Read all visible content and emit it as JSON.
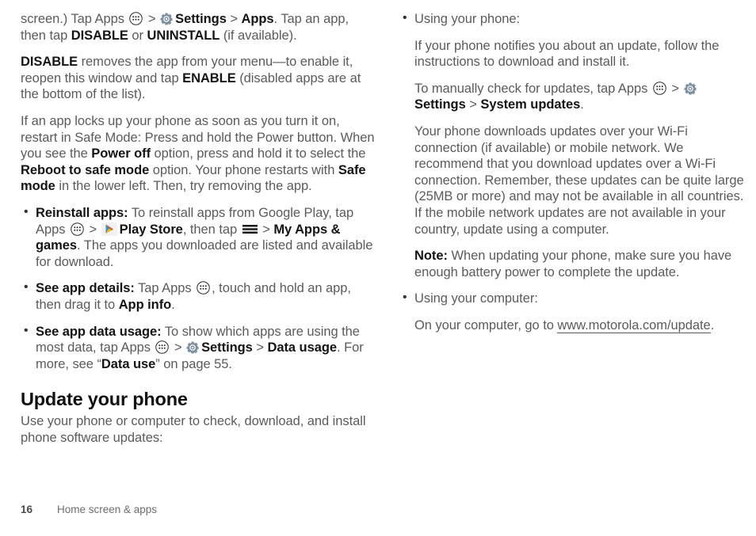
{
  "document": {
    "type": "user-guide-page",
    "page_number": "16",
    "chapter": "Home screen & apps"
  },
  "colors": {
    "body_text": "#5b5b5d",
    "bold_text": "#141414",
    "gear_icon": "#7f919e",
    "play_icon_green": "#34a853",
    "play_icon_blue": "#4285f4",
    "play_icon_yellow": "#fbbc04",
    "play_icon_red": "#ea4335"
  },
  "left_column": {
    "para_1": {
      "t1": "screen.) Tap Apps ",
      "icon_apps": "apps-icon",
      "t2": " > ",
      "icon_gear": "gear-icon",
      "b1": "Settings",
      "t3": " > ",
      "b2": "Apps",
      "t4": ". Tap an app, then tap ",
      "b3": "DISABLE",
      "t5": " or ",
      "b4": "UNINSTALL",
      "t6": " (if available)."
    },
    "para_2": {
      "b1": "DISABLE",
      "t1": " removes the app from your menu—to enable it, reopen this window and tap ",
      "b2": "ENABLE",
      "t2": " (disabled apps are at the bottom of the list)."
    },
    "para_3": {
      "t1": "If an app locks up your phone as soon as you turn it on, restart in Safe Mode: Press and hold the Power button. When you see the ",
      "b1": "Power off",
      "t2": " option, press and hold it to select the ",
      "b2": "Reboot to safe mode",
      "t3": " option. Your phone restarts with ",
      "b3": "Safe mode",
      "t4": " in the lower left. Then, try removing the app."
    },
    "bullet_reinstall": {
      "label": "Reinstall apps:",
      "t1": " To reinstall apps from Google Play, tap Apps ",
      "icon_apps": "apps-icon",
      "t2": " > ",
      "icon_play": "play-store-icon",
      "b1": "Play Store",
      "t3": ", then tap ",
      "icon_menu": "hamburger-menu-icon",
      "t4": " > ",
      "b2": "My Apps & games",
      "t5": ". The apps you downloaded are listed and available for download."
    },
    "bullet_app_details": {
      "label": "See app details:",
      "t1": " Tap Apps ",
      "icon_apps": "apps-icon",
      "t2": ", touch and hold an app, then drag it to ",
      "b1": "App info",
      "t3": "."
    },
    "bullet_data_usage": {
      "label": "See app data usage:",
      "t1": " To show which apps are using the most data, tap Apps ",
      "icon_apps": "apps-icon",
      "t2": " > ",
      "icon_gear": "gear-icon",
      "b1": "Settings",
      "t3": " > ",
      "b2": "Data usage",
      "t4": ". For more, see “",
      "b3": "Data use",
      "t5": "” on page 55."
    },
    "section_heading": "Update your phone",
    "section_intro": "Use your phone or computer to check, download, and install phone software updates:"
  },
  "right_column": {
    "bullet_using_phone": "Using your phone:",
    "sub_1": "If your phone notifies you about an update, follow the instructions to download and install it.",
    "sub_2": {
      "t1": "To manually check for updates, tap Apps ",
      "icon_apps": "apps-icon",
      "t2": " > ",
      "icon_gear": "gear-icon",
      "b1": "Settings",
      "t3": " > ",
      "b2": "System updates",
      "t4": "."
    },
    "sub_3": "Your phone downloads updates over your Wi-Fi connection (if available) or mobile network. We recommend that you download updates over a Wi-Fi connection. Remember, these updates can be quite large (25MB or more) and may not be available in all countries. If the mobile network updates are not available in your country, update using a computer.",
    "sub_note": {
      "label": "Note:",
      "text": " When updating your phone, make sure you have enough battery power to complete the update."
    },
    "bullet_using_computer": "Using your computer:",
    "sub_4": {
      "t1": "On your computer, go to ",
      "link": "www.motorola.com/update",
      "t2": "."
    }
  },
  "footer": {
    "page_number": "16",
    "chapter": "Home screen & apps"
  }
}
